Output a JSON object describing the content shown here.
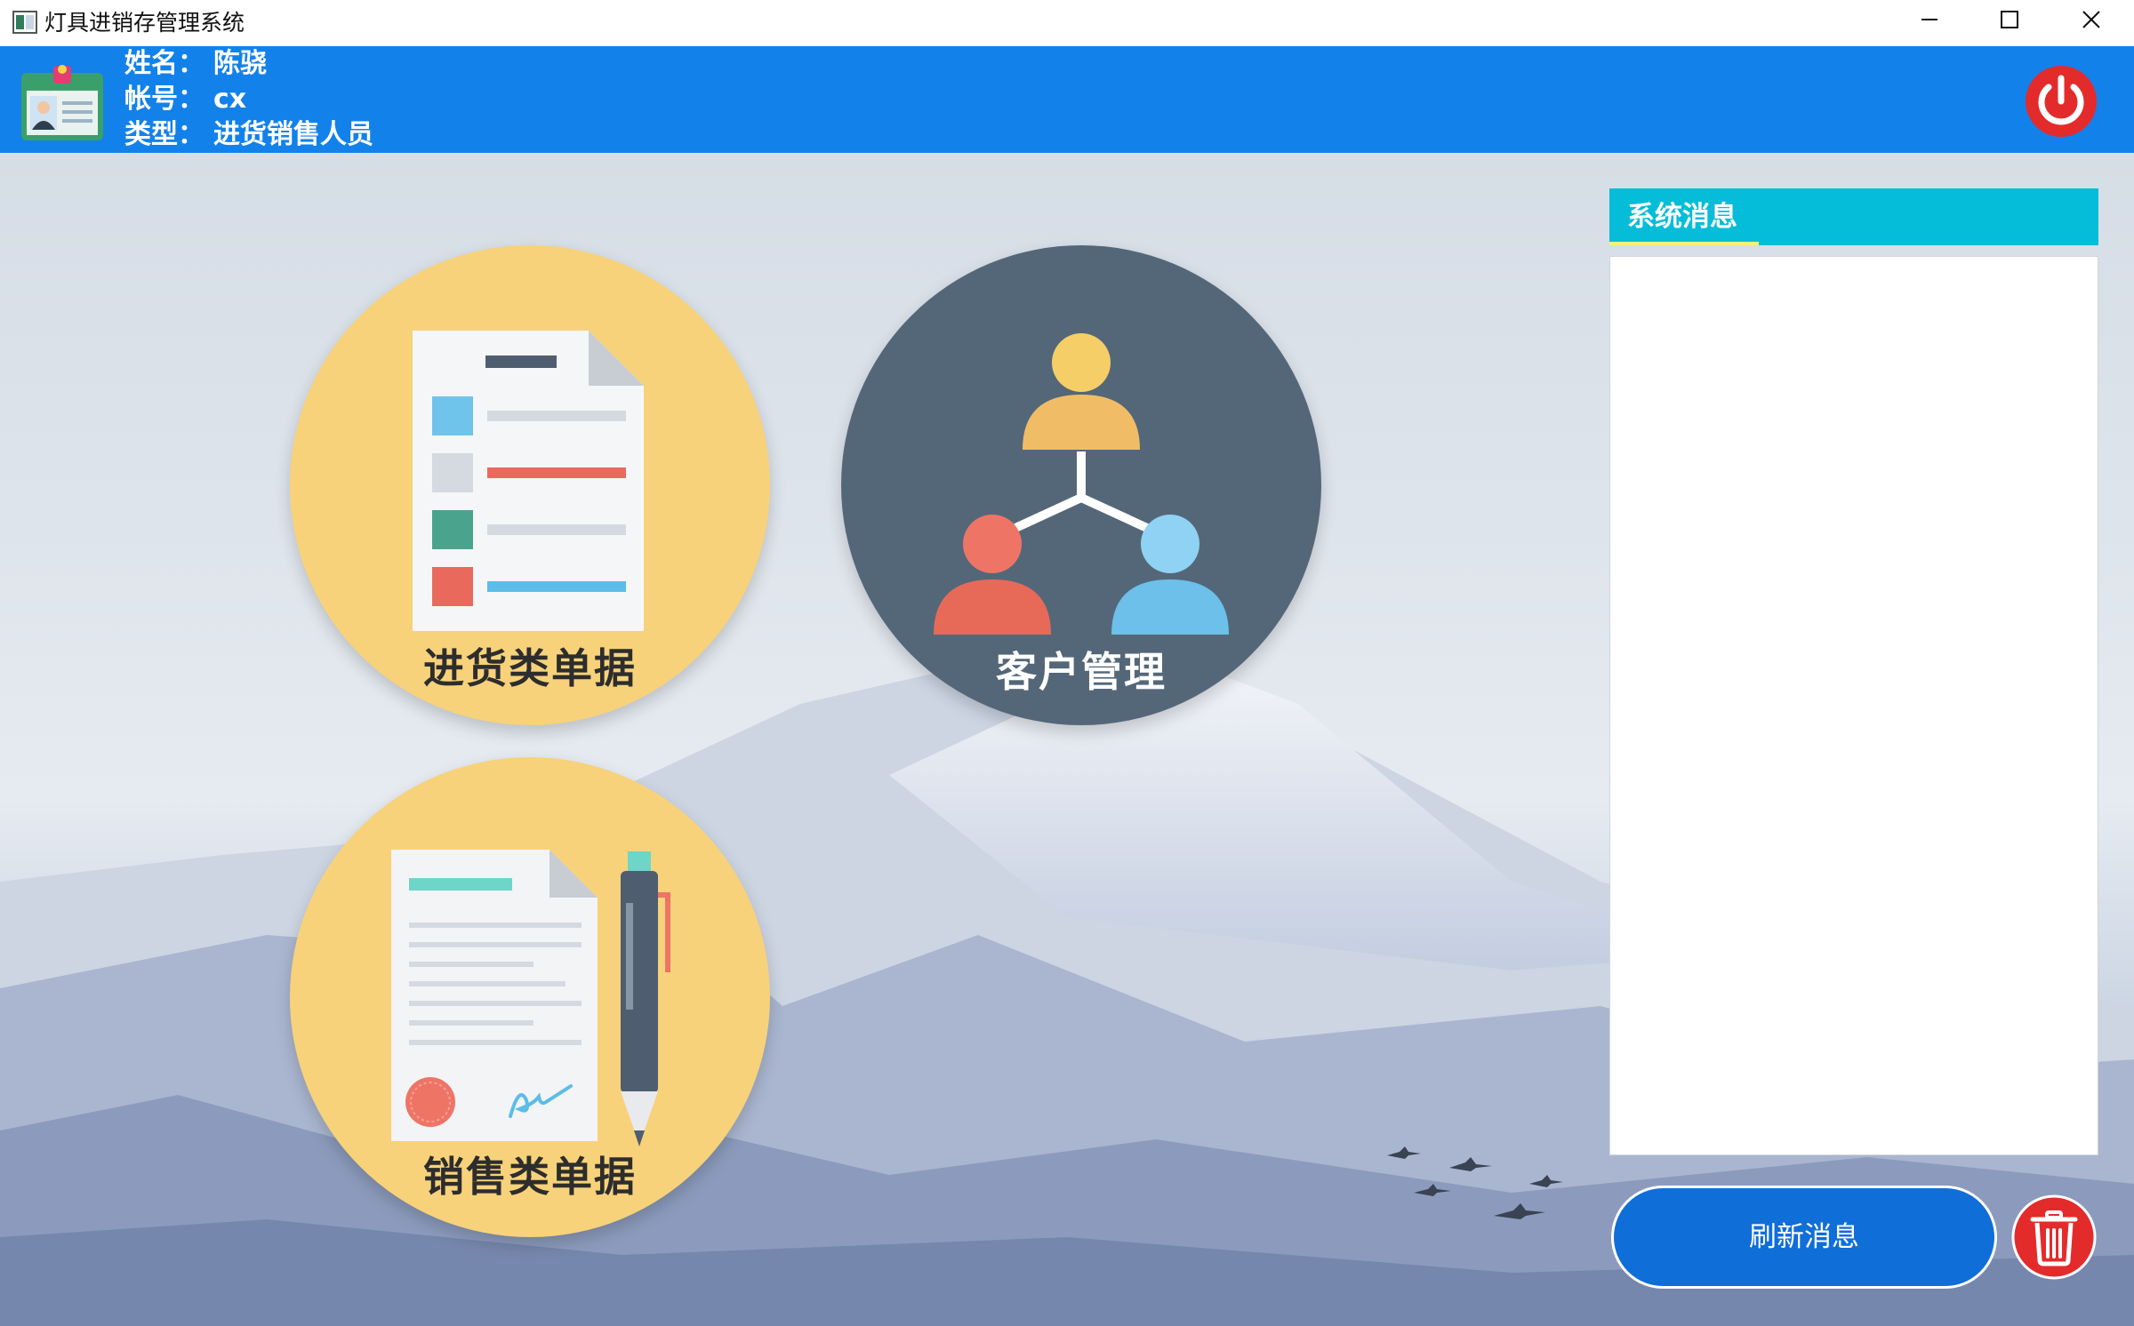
{
  "window": {
    "title": "灯具进销存管理系统",
    "controls": [
      "minimize",
      "maximize",
      "close"
    ]
  },
  "user": {
    "name_label": "姓名：",
    "name": "陈骁",
    "account_label": "帐号：",
    "account": "cx",
    "type_label": "类型：",
    "type": "进货销售人员"
  },
  "modules": [
    {
      "label": "进货类单据",
      "icon": "document-list-icon",
      "color": "#f7d27a"
    },
    {
      "label": "客户管理",
      "icon": "customer-network-icon",
      "color": "#546779"
    },
    {
      "label": "销售类单据",
      "icon": "contract-pen-icon",
      "color": "#f7d27a"
    }
  ],
  "messages": {
    "title": "系统消息",
    "items": [],
    "refresh_label": "刷新消息"
  },
  "colors": {
    "header": "#1381ea",
    "panel_header": "#06bdd9",
    "refresh_button": "#106ed9",
    "power_button": "#e42b2b",
    "trash_button": "#e42b2b"
  }
}
